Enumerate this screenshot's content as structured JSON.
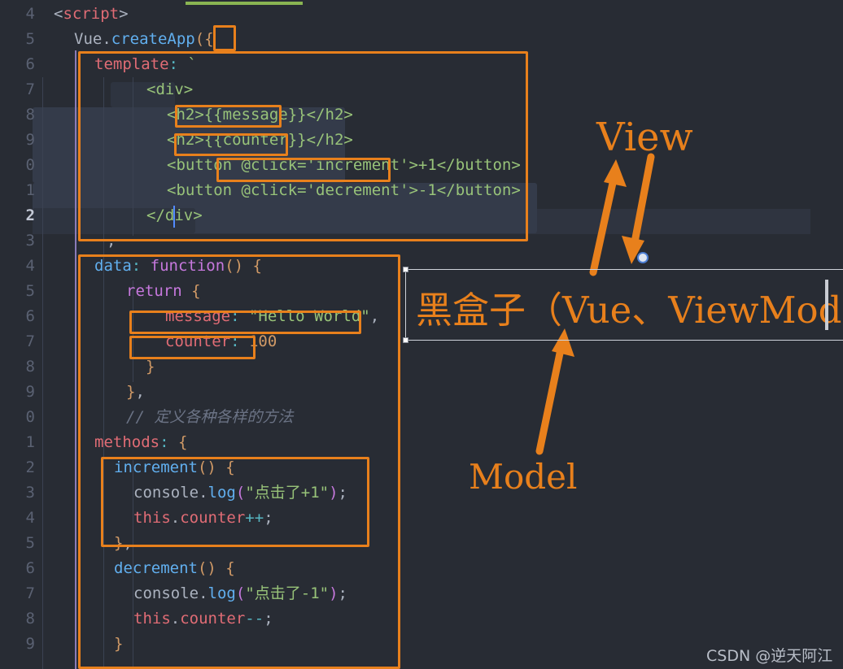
{
  "editor": {
    "theme_background": "#282c34",
    "active_line_number": "2",
    "gutter_line_numbers": [
      "4",
      "5",
      "6",
      "7",
      "8",
      "9",
      "0",
      "1",
      "2",
      "3",
      "4",
      "5",
      "6",
      "7",
      "8",
      "9",
      "0",
      "1",
      "2",
      "3",
      "4",
      "5",
      "6",
      "7",
      "8",
      "9"
    ],
    "code_lines": [
      "<script>",
      "Vue.createApp({",
      "template: `",
      "<div>",
      "<h2>{{message}}</h2>",
      "<h2>{{counter}}</h2>",
      "<button @click='increment'>+1</button>",
      "<button @click='decrement'>-1</button>",
      "</div>",
      ",",
      "data: function() {",
      "return {",
      "message: \"Hello World\",",
      "counter: 100",
      "}",
      "},",
      "// 定义各种各样的方法",
      "methods: {",
      "increment() {",
      "console.log(\"点击了+1\");",
      "this.counter++;",
      "},",
      "decrement() {",
      "console.log(\"点击了-1\");",
      "this.counter--;",
      "}"
    ],
    "tokens": {
      "script_tag": "script",
      "vue_object": "Vue",
      "create_app": "createApp",
      "template_key": "template",
      "backtick": "`",
      "div_open": "div",
      "div_close": "/div",
      "h2": "h2",
      "button": "button",
      "message_binding": "{{message}}",
      "counter_binding": "{{counter}}",
      "click_increment": "@click='increment'",
      "click_decrement": "@click='decrement'",
      "plus_one": "+1",
      "minus_one": "-1",
      "data_key": "data",
      "function_kw": "function",
      "return_kw": "return",
      "message_prop": "message",
      "message_value": "\"Hello World\"",
      "counter_prop": "counter",
      "counter_value": "100",
      "comment": "// 定义各种各样的方法",
      "methods_key": "methods",
      "increment_fn": "increment",
      "decrement_fn": "decrement",
      "console": "console",
      "log": "log",
      "log_plus_text": "\"点击了+1\"",
      "log_minus_text": "\"点击了-1\"",
      "this_kw": "this",
      "counter_ref": "counter",
      "increment_op": "++",
      "decrement_op": "--"
    }
  },
  "annotations": {
    "accent_color": "#e8801c",
    "view_label": "View",
    "model_label": "Model",
    "blackbox_label": "黑盒子（Vue、ViewModel）",
    "highlight_boxes": [
      {
        "name": "create-app-brace",
        "label": "{"
      },
      {
        "name": "template-block",
        "label": "template block"
      },
      {
        "name": "message-binding",
        "label": "{{message}}"
      },
      {
        "name": "counter-binding",
        "label": "{{counter}}"
      },
      {
        "name": "click-increment",
        "label": "@click='increment'"
      },
      {
        "name": "data-block",
        "label": "data block"
      },
      {
        "name": "message-line",
        "label": "message: \"Hello World\","
      },
      {
        "name": "counter-line",
        "label": "counter: 100"
      },
      {
        "name": "increment-method",
        "label": "increment method"
      }
    ]
  },
  "watermark": {
    "text": "CSDN @逆天阿江"
  }
}
